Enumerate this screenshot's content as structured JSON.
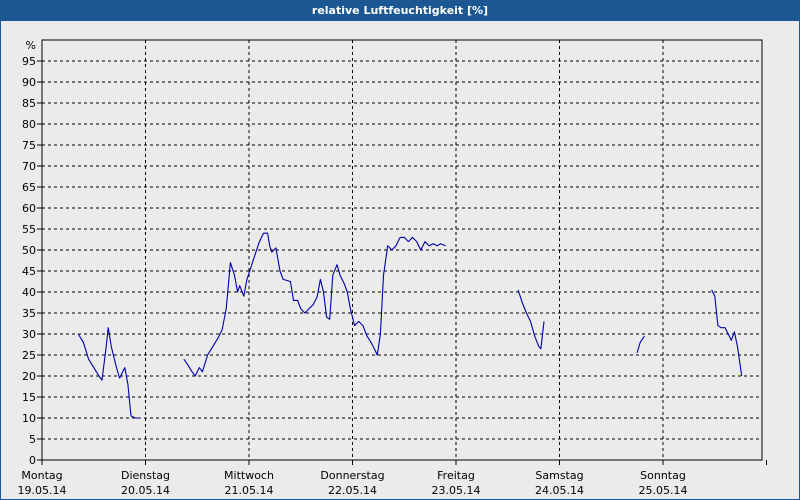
{
  "window": {
    "title": "relative Luftfeuchtigkeit [%]"
  },
  "colors": {
    "titlebar": "#1b5793",
    "line": "#0000aa",
    "background": "#ebebeb"
  },
  "chart_data": {
    "type": "line",
    "title": "relative Luftfeuchtigkeit [%]",
    "ylabel": "%",
    "ylim": [
      0,
      100
    ],
    "yticks": [
      0,
      5,
      10,
      15,
      20,
      25,
      30,
      35,
      40,
      45,
      50,
      55,
      60,
      65,
      70,
      75,
      80,
      85,
      90,
      95
    ],
    "xlim": [
      0,
      7
    ],
    "x_unit": "days",
    "grid": true,
    "day_labels": [
      {
        "day": "Montag",
        "date": "19.05.14"
      },
      {
        "day": "Dienstag",
        "date": "20.05.14"
      },
      {
        "day": "Mittwoch",
        "date": "21.05.14"
      },
      {
        "day": "Donnerstag",
        "date": "22.05.14"
      },
      {
        "day": "Freitag",
        "date": "23.05.14"
      },
      {
        "day": "Samstag",
        "date": "24.05.14"
      },
      {
        "day": "Sonntag",
        "date": "25.05.14"
      }
    ],
    "series": [
      {
        "segments": [
          [
            [
              0.35,
              30
            ],
            [
              0.4,
              28
            ],
            [
              0.45,
              24
            ],
            [
              0.5,
              22
            ],
            [
              0.55,
              20
            ],
            [
              0.58,
              19
            ],
            [
              0.62,
              27
            ],
            [
              0.64,
              31.5
            ],
            [
              0.67,
              27
            ],
            [
              0.7,
              24
            ],
            [
              0.72,
              22
            ],
            [
              0.75,
              19.5
            ],
            [
              0.78,
              21
            ],
            [
              0.8,
              22
            ],
            [
              0.83,
              18
            ],
            [
              0.86,
              10.5
            ],
            [
              0.9,
              10
            ],
            [
              0.94,
              10
            ]
          ],
          [
            [
              1.37,
              24
            ],
            [
              1.4,
              23
            ],
            [
              1.45,
              21
            ],
            [
              1.48,
              20
            ],
            [
              1.52,
              22
            ],
            [
              1.55,
              21
            ],
            [
              1.6,
              25
            ],
            [
              1.65,
              27
            ],
            [
              1.7,
              29
            ],
            [
              1.74,
              31
            ],
            [
              1.78,
              36
            ],
            [
              1.82,
              47
            ],
            [
              1.86,
              44
            ],
            [
              1.89,
              40
            ],
            [
              1.91,
              41.5
            ],
            [
              1.95,
              39
            ],
            [
              1.98,
              43
            ],
            [
              2.02,
              46
            ],
            [
              2.06,
              49
            ],
            [
              2.1,
              52
            ],
            [
              2.14,
              54
            ],
            [
              2.18,
              54
            ],
            [
              2.2,
              51
            ],
            [
              2.22,
              49.5
            ],
            [
              2.26,
              50.5
            ],
            [
              2.3,
              45
            ],
            [
              2.33,
              43
            ],
            [
              2.4,
              42.5
            ],
            [
              2.43,
              38
            ],
            [
              2.47,
              38
            ],
            [
              2.5,
              36
            ],
            [
              2.54,
              35
            ],
            [
              2.58,
              36
            ],
            [
              2.62,
              37
            ],
            [
              2.66,
              39
            ],
            [
              2.69,
              43
            ],
            [
              2.72,
              40
            ],
            [
              2.75,
              34
            ],
            [
              2.78,
              33.5
            ],
            [
              2.81,
              44
            ],
            [
              2.85,
              46.5
            ],
            [
              2.88,
              44
            ],
            [
              2.92,
              42
            ],
            [
              2.95,
              40
            ],
            [
              2.98,
              36
            ],
            [
              3.02,
              32
            ],
            [
              3.06,
              33
            ],
            [
              3.1,
              32
            ],
            [
              3.14,
              29.5
            ],
            [
              3.18,
              28
            ],
            [
              3.22,
              26
            ],
            [
              3.24,
              25
            ],
            [
              3.27,
              30
            ],
            [
              3.3,
              44
            ],
            [
              3.34,
              51
            ],
            [
              3.38,
              50
            ],
            [
              3.42,
              51
            ],
            [
              3.46,
              53
            ],
            [
              3.5,
              53
            ],
            [
              3.54,
              52
            ],
            [
              3.58,
              53
            ],
            [
              3.62,
              52
            ],
            [
              3.66,
              50
            ],
            [
              3.7,
              52
            ],
            [
              3.74,
              51
            ],
            [
              3.78,
              51.5
            ],
            [
              3.82,
              51
            ],
            [
              3.85,
              51.5
            ],
            [
              3.9,
              51
            ]
          ],
          [
            [
              4.6,
              40.5
            ],
            [
              4.64,
              37.5
            ],
            [
              4.68,
              35
            ],
            [
              4.72,
              33
            ],
            [
              4.76,
              29.5
            ],
            [
              4.8,
              27
            ],
            [
              4.82,
              26.5
            ],
            [
              4.85,
              33
            ]
          ],
          [
            [
              5.75,
              25.5
            ],
            [
              5.78,
              28
            ],
            [
              5.82,
              29.5
            ]
          ],
          [
            [
              6.47,
              40.5
            ],
            [
              6.5,
              39
            ],
            [
              6.53,
              32
            ],
            [
              6.56,
              31.5
            ],
            [
              6.6,
              31.5
            ],
            [
              6.63,
              30
            ],
            [
              6.66,
              28.5
            ],
            [
              6.69,
              30.5
            ],
            [
              6.72,
              27
            ],
            [
              6.76,
              20
            ]
          ]
        ]
      }
    ]
  }
}
